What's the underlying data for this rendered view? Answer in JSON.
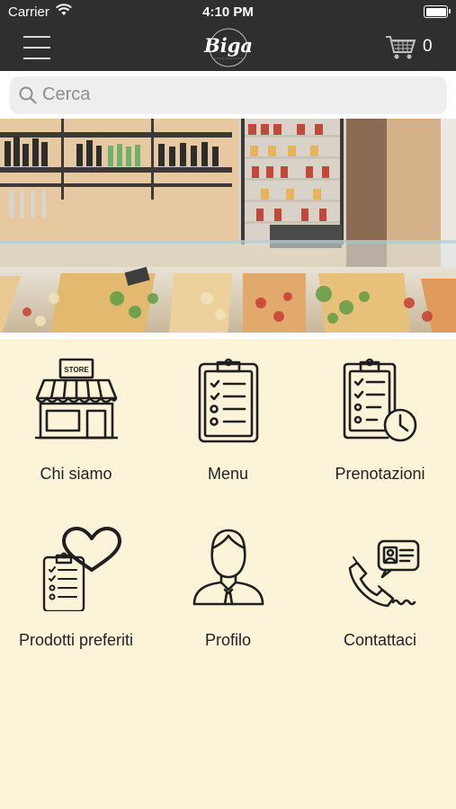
{
  "status_bar": {
    "carrier": "Carrier",
    "time": "4:10 PM"
  },
  "navbar": {
    "logo_text": "Biga",
    "cart_count": "0"
  },
  "search": {
    "placeholder": "Cerca"
  },
  "menu_tiles": [
    {
      "label": "Chi siamo",
      "icon": "store-icon"
    },
    {
      "label": "Menu",
      "icon": "clipboard-list-icon"
    },
    {
      "label": "Prenotazioni",
      "icon": "clipboard-clock-icon"
    },
    {
      "label": "Prodotti preferiti",
      "icon": "favorite-list-icon"
    },
    {
      "label": "Profilo",
      "icon": "user-icon"
    },
    {
      "label": "Contattaci",
      "icon": "phone-contact-icon"
    }
  ],
  "store_sign": "STORE",
  "colors": {
    "bar": "#2f2f2f",
    "background": "#fbf4d9",
    "icon_stroke": "#1f1f1f"
  }
}
